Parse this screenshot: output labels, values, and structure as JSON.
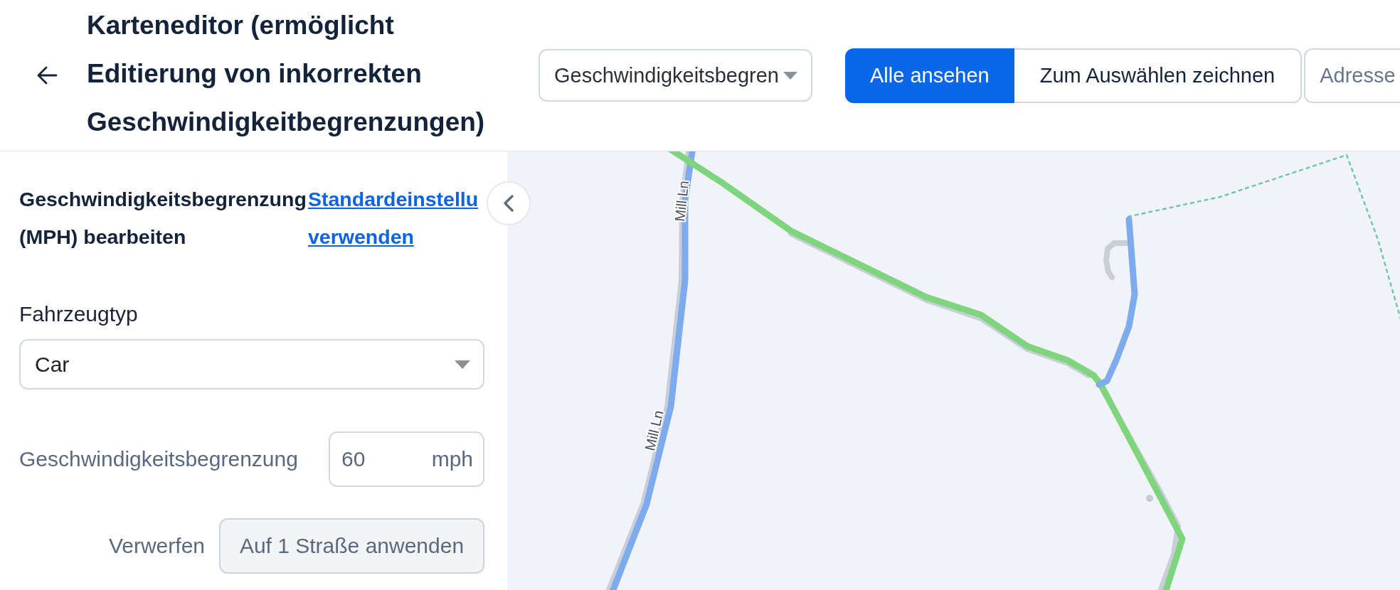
{
  "header": {
    "title": "Karteneditor (ermöglicht Editierung von inkorrekten Geschwindigkeitbegrenzungen)",
    "layer_select": {
      "value": "Geschwindigkeitsbegren"
    },
    "view_modes": [
      {
        "label": "Alle ansehen",
        "selected": true
      },
      {
        "label": "Zum Auswählen zeichnen",
        "selected": false
      }
    ],
    "address_field": {
      "placeholder": "Adresse"
    }
  },
  "panel": {
    "heading": "Geschwindigkeitsbegrenzung (MPH) bearbeiten",
    "default_link": "Standardeinstellu verwenden",
    "vehicle_type": {
      "label": "Fahrzeugtyp",
      "value": "Car"
    },
    "speed_limit": {
      "label": "Geschwindigkeitsbegrenzung",
      "value": "60",
      "unit": "mph"
    },
    "discard_button": "Verwerfen",
    "apply_button": {
      "label": "Auf 1 Straße anwenden",
      "disabled": true
    }
  },
  "map": {
    "roads": [
      {
        "color": "#7eaaee"
      },
      {
        "color": "#7fd47e"
      },
      {
        "color": "#7eaaee"
      }
    ],
    "road_labels": [
      "Mill Ln",
      "Mill Ln"
    ]
  }
}
